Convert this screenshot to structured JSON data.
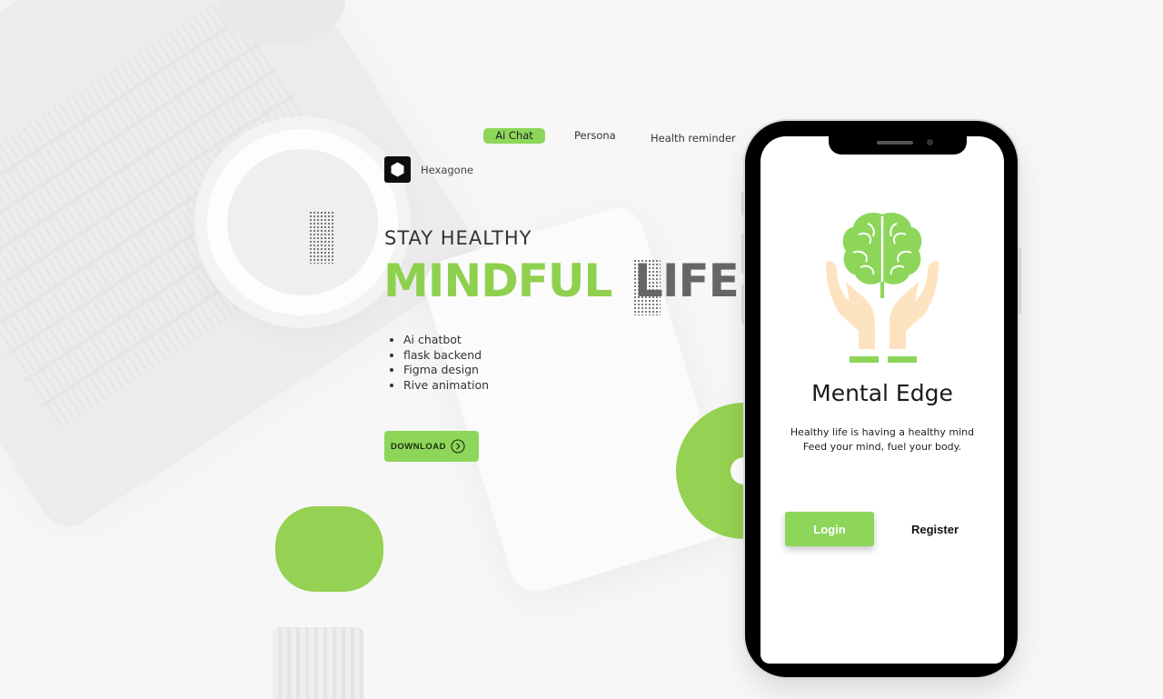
{
  "nav": {
    "items": [
      {
        "label": "Ai Chat",
        "active": true
      },
      {
        "label": "Persona",
        "active": false
      },
      {
        "label": "Health reminder",
        "active": false
      }
    ]
  },
  "brand": {
    "name": "Hexagone",
    "icon": "hexagon-icon"
  },
  "hero": {
    "eyebrow": "STAY HEALTHY",
    "headline_1": "MINDFUL",
    "headline_2": "LIFE",
    "features": [
      "Ai chatbot",
      "flask backend",
      "Figma design",
      "Rive animation"
    ],
    "download_label": "DOWNLOAD",
    "download_icon": "chevron-right-circle-icon"
  },
  "app": {
    "logo_icon": "brain-in-hands-icon",
    "title": "Mental Edge",
    "tagline_1": "Healthy life is having a healthy mind",
    "tagline_2": "Feed your mind, fuel your body.",
    "login_label": "Login",
    "register_label": "Register"
  },
  "colors": {
    "accent": "#8dd65a",
    "headline_green": "#8fd04f",
    "headline_gray": "#666666",
    "hands": "#fde3c0"
  }
}
